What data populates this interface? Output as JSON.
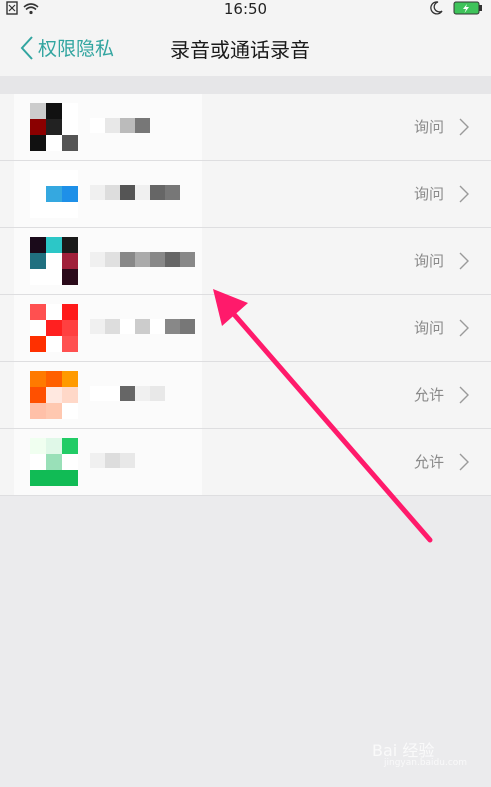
{
  "status_bar": {
    "time": "16:50"
  },
  "header": {
    "back_label": "权限隐私",
    "title": "录音或通话录音"
  },
  "apps": [
    {
      "permission": "询问",
      "icon": [
        "#cccccc",
        "#111111",
        "#ffffff",
        "#8b0000",
        "#222222",
        "#ffffff",
        "#111111",
        "#ffffff",
        "#555555"
      ],
      "blur": [
        "#ffffff",
        "#e8e8e8",
        "#bbbbbb",
        "#777777"
      ]
    },
    {
      "permission": "询问",
      "icon": [
        "#ffffff",
        "#ffffff",
        "#ffffff",
        "#ffffff",
        "#35a8e0",
        "#1e90e8",
        "#ffffff",
        "#ffffff",
        "#ffffff"
      ],
      "blur": [
        "#f0f0f0",
        "#dddddd",
        "#555555",
        "#f0f0f0",
        "#666666",
        "#777777"
      ]
    },
    {
      "permission": "询问",
      "icon": [
        "#1a0a1a",
        "#2cc7c7",
        "#1a1a1a",
        "#207080",
        "#ffffff",
        "#a0203a",
        "#ffffff",
        "#ffffff",
        "#2a0a1a"
      ],
      "blur": [
        "#f0f0f0",
        "#e0e0e0",
        "#888888",
        "#aaaaaa",
        "#888888",
        "#666666",
        "#888888"
      ]
    },
    {
      "permission": "询问",
      "icon": [
        "#ff5050",
        "#ffffff",
        "#ff1a1a",
        "#ffffff",
        "#ff2020",
        "#ff4040",
        "#ff3000",
        "#ffffff",
        "#ff5050"
      ],
      "blur": [
        "#f0f0f0",
        "#dddddd",
        "#ffffff",
        "#cccccc",
        "#ffffff",
        "#888888",
        "#777777"
      ]
    },
    {
      "permission": "允许",
      "icon": [
        "#ff7a00",
        "#ff6000",
        "#ff9a00",
        "#ff5000",
        "#ffe8e0",
        "#ffd8c8",
        "#ffc0a8",
        "#ffc8b0",
        "#ffffff"
      ],
      "blur": [
        "#ffffff",
        "#ffffff",
        "#666666",
        "#f0f0f0",
        "#e8e8e8"
      ]
    },
    {
      "permission": "允许",
      "icon": [
        "#f0fff0",
        "#e0f8e8",
        "#22cc66",
        "#ffffff",
        "#99e0b8",
        "#ffffff",
        "#11bb55",
        "#11bb55",
        "#11bb55"
      ],
      "blur": [
        "#f0f0f0",
        "#dddddd",
        "#e8e8e8"
      ]
    }
  ],
  "watermark": {
    "brand": "Bai 经验",
    "url": "jingyan.baidu.com"
  },
  "colors": {
    "accent": "#32a5a0",
    "arrow": "#ff1a6b"
  }
}
